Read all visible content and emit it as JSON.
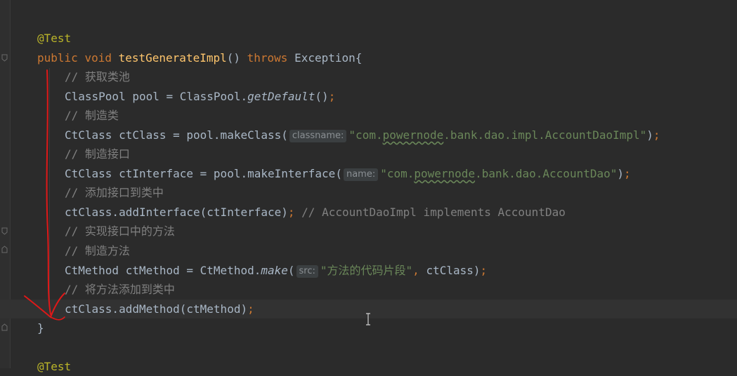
{
  "editor": {
    "lines": [
      {
        "id": "l1",
        "parts": [
          {
            "t": "@Test",
            "c": "annotation"
          }
        ]
      },
      {
        "id": "l2",
        "parts": [
          {
            "t": "public ",
            "c": "kw"
          },
          {
            "t": "void ",
            "c": "kw"
          },
          {
            "t": "testGenerateImpl",
            "c": "fn"
          },
          {
            "t": "() ",
            "c": "plain"
          },
          {
            "t": "throws ",
            "c": "kw"
          },
          {
            "t": "Exception{",
            "c": "plain"
          }
        ]
      },
      {
        "id": "l3",
        "parts": [
          {
            "t": "// 获取类池",
            "c": "cmt"
          }
        ]
      },
      {
        "id": "l4",
        "parts": [
          {
            "t": "ClassPool pool = ClassPool.",
            "c": "plain"
          },
          {
            "t": "getDefault",
            "c": "it"
          },
          {
            "t": "()",
            "c": "plain"
          },
          {
            "t": ";",
            "c": "semi"
          }
        ]
      },
      {
        "id": "l5",
        "parts": [
          {
            "t": "// 制造类",
            "c": "cmt"
          }
        ]
      },
      {
        "id": "l6",
        "parts": [
          {
            "t": "CtClass ctClass = pool.makeClass(",
            "c": "plain"
          },
          {
            "t": "classname:",
            "c": "hint"
          },
          {
            "t": "\"com.",
            "c": "str"
          },
          {
            "t": "powernode",
            "c": "str squig"
          },
          {
            "t": ".bank.dao.impl.AccountDaoImpl\"",
            "c": "str"
          },
          {
            "t": ")",
            "c": "plain"
          },
          {
            "t": ";",
            "c": "semi"
          }
        ]
      },
      {
        "id": "l7",
        "parts": [
          {
            "t": "// 制造接口",
            "c": "cmt"
          }
        ]
      },
      {
        "id": "l8",
        "parts": [
          {
            "t": "CtClass ctInterface = pool.makeInterface(",
            "c": "plain"
          },
          {
            "t": "name:",
            "c": "hint"
          },
          {
            "t": "\"com.",
            "c": "str"
          },
          {
            "t": "powernode",
            "c": "str squig"
          },
          {
            "t": ".bank.dao.AccountDao\"",
            "c": "str"
          },
          {
            "t": ")",
            "c": "plain"
          },
          {
            "t": ";",
            "c": "semi"
          }
        ]
      },
      {
        "id": "l9",
        "parts": [
          {
            "t": "// 添加接口到类中",
            "c": "cmt"
          }
        ]
      },
      {
        "id": "l10",
        "parts": [
          {
            "t": "ctClass.addInterface(ctInterface)",
            "c": "plain"
          },
          {
            "t": ";",
            "c": "semi"
          },
          {
            "t": " // AccountDaoImpl implements AccountDao",
            "c": "cmt"
          }
        ]
      },
      {
        "id": "l11",
        "parts": [
          {
            "t": "// 实现接口中的方法",
            "c": "cmt"
          }
        ]
      },
      {
        "id": "l12",
        "parts": [
          {
            "t": "// 制造方法",
            "c": "cmt"
          }
        ]
      },
      {
        "id": "l13",
        "parts": [
          {
            "t": "CtMethod ctMethod = CtMethod.",
            "c": "plain"
          },
          {
            "t": "make",
            "c": "it"
          },
          {
            "t": "(",
            "c": "plain"
          },
          {
            "t": "src:",
            "c": "hint"
          },
          {
            "t": "\"方法的代码片段\"",
            "c": "str"
          },
          {
            "t": ", ",
            "c": "semi"
          },
          {
            "t": "ctClass)",
            "c": "plain"
          },
          {
            "t": ";",
            "c": "semi"
          }
        ]
      },
      {
        "id": "l14",
        "parts": [
          {
            "t": "// 将方法添加到类中",
            "c": "cmt"
          }
        ]
      },
      {
        "id": "l15",
        "parts": [
          {
            "t": "ctClass.addMethod(ctMethod)",
            "c": "plain"
          },
          {
            "t": ";",
            "c": "semi"
          }
        ]
      },
      {
        "id": "l16",
        "parts": [
          {
            "t": "}",
            "c": "plain"
          }
        ]
      },
      {
        "id": "l17",
        "parts": []
      },
      {
        "id": "l18",
        "parts": [
          {
            "t": "@Test",
            "c": "annotation"
          }
        ]
      }
    ]
  },
  "colors": {
    "background": "#2b2b2b",
    "keyword": "#cc7832",
    "function": "#ffc66d",
    "string": "#6a8759",
    "comment": "#808080",
    "annotation": "#bbb529",
    "plain": "#a9b7c6",
    "red_markup": "#e01818"
  },
  "icons": [
    "fold-marker-icon",
    "text-cursor-icon"
  ]
}
